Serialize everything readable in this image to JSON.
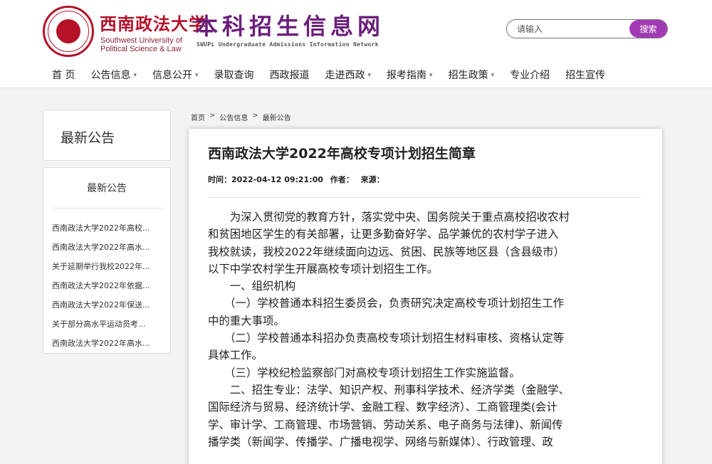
{
  "header": {
    "brand_cn": "西南政法大学",
    "brand_en_line1": "Southwest University of",
    "brand_en_line2": "Political Science & Law",
    "site_title": "本科招生信息网",
    "site_subtitle": "SWUPL Undergraduate Admissions Information Network",
    "accent_color": "#b5122a",
    "title_color": "#6a1f7a"
  },
  "search": {
    "placeholder": "请输入",
    "button_label": "搜索",
    "button_color": "#a23bb3"
  },
  "nav": {
    "items": [
      {
        "label": "首 页",
        "has_dropdown": false
      },
      {
        "label": "公告信息",
        "has_dropdown": true
      },
      {
        "label": "信息公开",
        "has_dropdown": true
      },
      {
        "label": "录取查询",
        "has_dropdown": false
      },
      {
        "label": "西政报道",
        "has_dropdown": false
      },
      {
        "label": "走进西政",
        "has_dropdown": true
      },
      {
        "label": "报考指南",
        "has_dropdown": true
      },
      {
        "label": "招生政策",
        "has_dropdown": true
      },
      {
        "label": "专业介绍",
        "has_dropdown": false
      },
      {
        "label": "招生宣传",
        "has_dropdown": false
      }
    ],
    "caret": "▾"
  },
  "sidebar": {
    "title": "最新公告",
    "list_heading": "最新公告",
    "items": [
      {
        "label": "西南政法大学2022年高校..."
      },
      {
        "label": "西南政法大学2022年高水..."
      },
      {
        "label": "关于延期举行我校2022年..."
      },
      {
        "label": "西南政法大学2022年依据..."
      },
      {
        "label": "西南政法大学2022年保送..."
      },
      {
        "label": "关于部分高水平运动员考..."
      },
      {
        "label": "西南政法大学2022年高水..."
      }
    ]
  },
  "breadcrumb": {
    "items": [
      "首页",
      "公告信息",
      "最新公告"
    ],
    "separator": ">"
  },
  "article": {
    "title": "西南政法大学2022年高校专项计划招生简章",
    "meta_time": "时间：2022-04-12 09:21:00",
    "meta_author": "作者：",
    "meta_source": "来源：",
    "body_lines": [
      "　　为深入贯彻党的教育方针，落实党中央、国务院关于重点高校招收农村",
      "和贫困地区学生的有关部署，让更多勤奋好学、品学兼优的农村学子进入",
      "我校就读，我校2022年继续面向边远、贫困、民族等地区县（含县级市）",
      "以下中学农村学生开展高校专项计划招生工作。",
      "　　一、组织机构",
      "　　（一）学校普通本科招生委员会，负责研究决定高校专项计划招生工作",
      "中的重大事项。",
      "　　（二）学校普通本科招办负责高校专项计划招生材料审核、资格认定等",
      "具体工作。",
      "　　（三）学校纪检监察部门对高校专项计划招生工作实施监督。",
      "　　二、招生专业：法学、知识产权、刑事科学技术、经济学类（金融学、",
      "国际经济与贸易、经济统计学、金融工程、数字经济）、工商管理类(会计",
      "学、审计学、工商管理、市场营销、劳动关系、电子商务与法律)、新闻传",
      "播学类（新闻学、传播学、广播电视学、网络与新媒体）、行政管理、政"
    ]
  }
}
